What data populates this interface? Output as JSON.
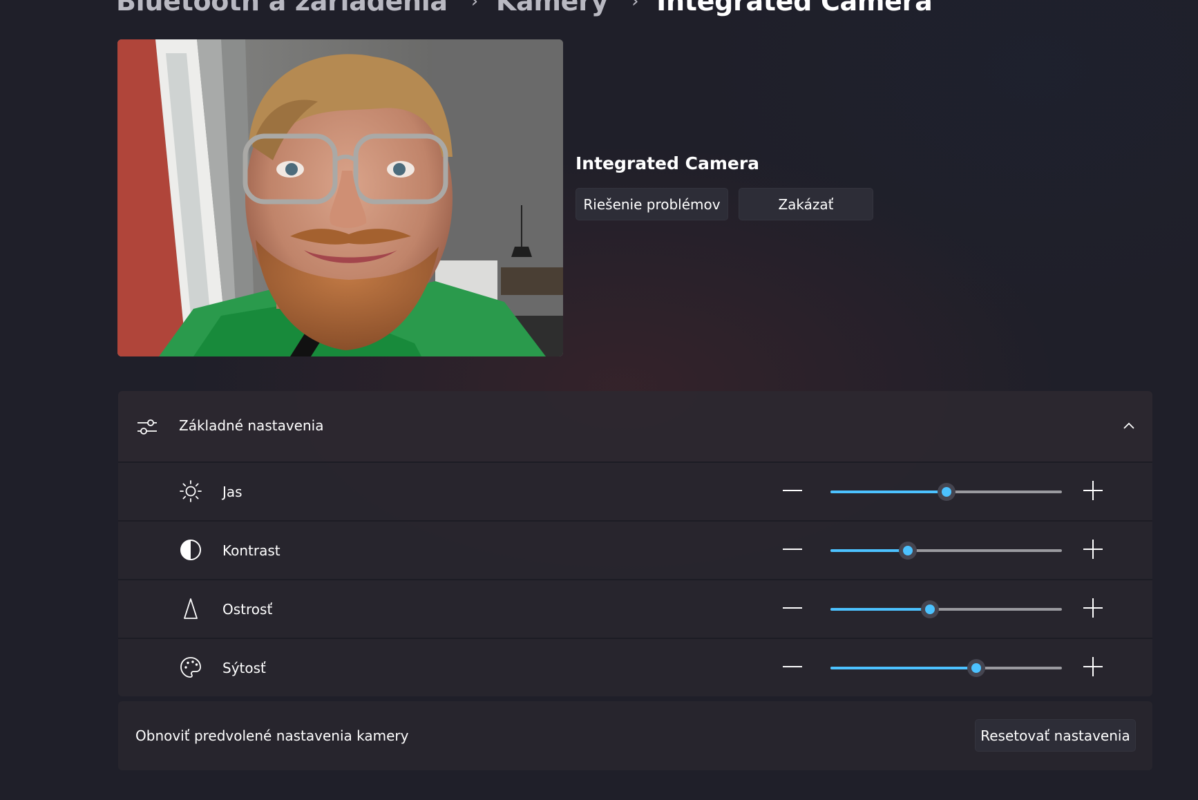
{
  "breadcrumb": {
    "items": [
      "Bluetooth a zariadenia",
      "Kamery",
      "Integrated Camera"
    ],
    "separator": "›"
  },
  "camera": {
    "name": "Integrated Camera",
    "troubleshoot_label": "Riešenie problémov",
    "disable_label": "Zakázať"
  },
  "settings": {
    "header_label": "Základné nastavenia",
    "header_icon": "sliders-icon",
    "expanded": true,
    "rows": [
      {
        "label": "Jas",
        "icon": "brightness-icon",
        "value": 0.5
      },
      {
        "label": "Kontrast",
        "icon": "contrast-icon",
        "value": 0.335
      },
      {
        "label": "Ostrosť",
        "icon": "sharpness-icon",
        "value": 0.43
      },
      {
        "label": "Sýtosť",
        "icon": "palette-icon",
        "value": 0.63
      }
    ]
  },
  "reset": {
    "label": "Obnoviť predvolené nastavenia kamery",
    "button_label": "Resetovať nastavenia"
  },
  "colors": {
    "accent": "#4cc2ff",
    "background": "#1f1f29",
    "card": "#28262e"
  }
}
